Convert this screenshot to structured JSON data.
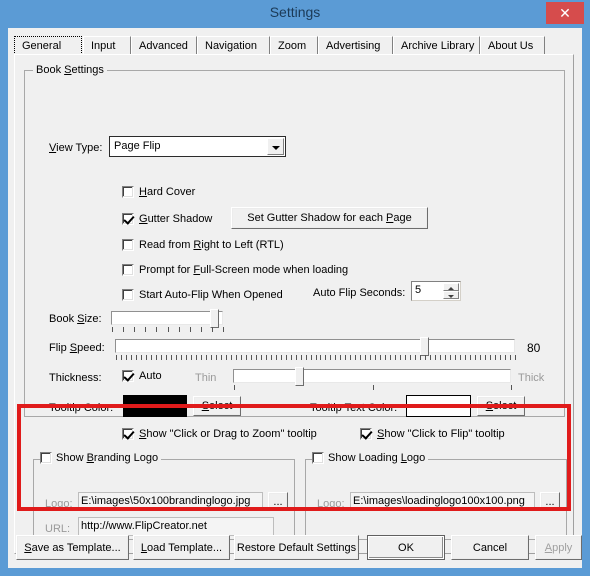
{
  "window": {
    "title": "Settings",
    "close_label": "✕",
    "accent_color": "#5b9bd5",
    "close_color": "#d64c4c",
    "highlight_color": "#e01b1b"
  },
  "tabs": [
    {
      "label": "General",
      "active": true
    },
    {
      "label": "Input",
      "active": false
    },
    {
      "label": "Advanced",
      "active": false
    },
    {
      "label": "Navigation",
      "active": false
    },
    {
      "label": "Zoom",
      "active": false
    },
    {
      "label": "Advertising",
      "active": false
    },
    {
      "label": "Archive Library",
      "active": false
    },
    {
      "label": "About Us",
      "active": false
    }
  ],
  "book_settings": {
    "group_title": "Book Settings",
    "view_type_label": "View Type:",
    "view_type_value": "Page Flip",
    "view_type_options": [
      "Page Flip"
    ],
    "hard_cover_label": "Hard Cover",
    "hard_cover_checked": false,
    "gutter_shadow_label": "Gutter Shadow",
    "gutter_shadow_checked": true,
    "gutter_shadow_button": "Set Gutter Shadow for each Page",
    "rtl_label": "Read from Right to Left (RTL)",
    "rtl_checked": false,
    "fullscreen_label": "Prompt for Full-Screen mode when loading",
    "fullscreen_checked": false,
    "autoflip_label": "Start Auto-Flip When Opened",
    "autoflip_checked": false,
    "auto_flip_seconds_label": "Auto Flip Seconds:",
    "auto_flip_seconds_value": "5",
    "book_size_label": "Book Size:",
    "book_size_percent": 96,
    "flip_speed_label": "Flip Speed:",
    "flip_speed_value": "80",
    "flip_speed_percent": 78,
    "thickness_label": "Thickness:",
    "thickness_auto_label": "Auto",
    "thickness_auto_checked": true,
    "thin_label": "Thin",
    "thick_label": "Thick",
    "thickness_percent": 23,
    "tooltip_color_label": "Tooltip Color:",
    "tooltip_color_value": "#000000",
    "tooltip_color_select": "Select",
    "tooltip_text_color_label": "Tooltip Text Color:",
    "tooltip_text_color_value": "#ffffff",
    "tooltip_text_color_select": "Select",
    "zoom_tooltip_label": "Show \"Click or Drag to Zoom\" tooltip",
    "zoom_tooltip_checked": true,
    "flip_tooltip_label": "Show \"Click to Flip\" tooltip",
    "flip_tooltip_checked": true
  },
  "branding_logo": {
    "group_title": "Show Branding Logo",
    "enabled": false,
    "logo_label": "Logo:",
    "logo_value": "E:\\images\\50x100brandinglogo.jpg",
    "browse_label": "...",
    "url_label": "URL:",
    "url_value": "http://www.FlipCreator.net"
  },
  "loading_logo": {
    "group_title": "Show Loading Logo",
    "enabled": false,
    "logo_label": "Logo:",
    "logo_value": "E:\\images\\loadinglogo100x100.png",
    "browse_label": "..."
  },
  "footer": {
    "save_as_template": "Save as Template...",
    "load_template": "Load Template...",
    "restore_defaults": "Restore Default Settings",
    "ok": "OK",
    "cancel": "Cancel",
    "apply": "Apply"
  }
}
